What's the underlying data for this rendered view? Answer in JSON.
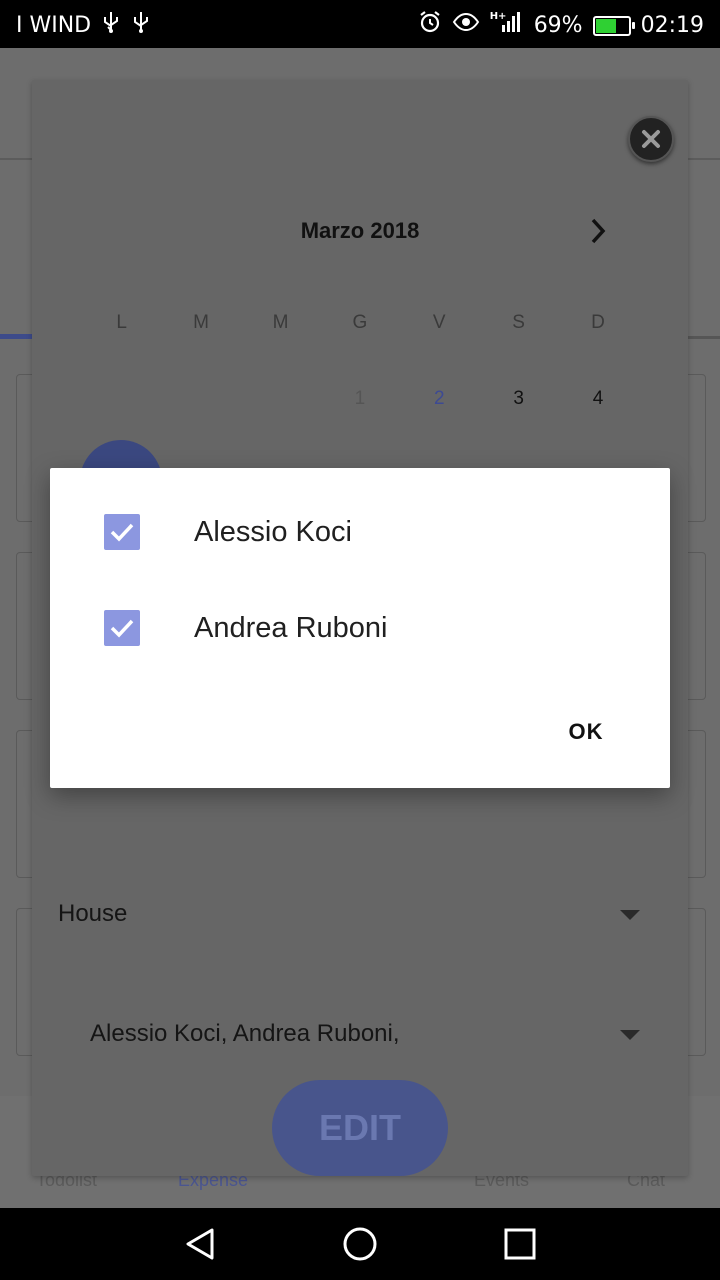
{
  "status_bar": {
    "carrier": "I WIND",
    "left_icons": [
      "usb-icon",
      "usb-icon"
    ],
    "right_icons": [
      "alarm-icon",
      "eye-icon",
      "signal-icon"
    ],
    "network": "H+",
    "battery_percent": "69%",
    "battery_level": 0.69,
    "time": "02:19"
  },
  "calendar": {
    "month_title": "Marzo 2018",
    "weekdays": [
      "L",
      "M",
      "M",
      "G",
      "V",
      "S",
      "D"
    ],
    "first_week": [
      "1",
      "2",
      "3",
      "4"
    ]
  },
  "form": {
    "category_value": "House",
    "participants_value": "Alessio Koci, Andrea Ruboni,"
  },
  "edit_button": {
    "label": "EDIT"
  },
  "bottom_tabs": [
    "Todolist",
    "Expense",
    "Events",
    "Chat"
  ],
  "dialog": {
    "options": [
      {
        "label": "Alessio Koci",
        "checked": true
      },
      {
        "label": "Andrea Ruboni",
        "checked": true
      }
    ],
    "ok_label": "OK"
  },
  "colors": {
    "checkbox": "#8c97e0",
    "accent": "#3d4a93"
  }
}
